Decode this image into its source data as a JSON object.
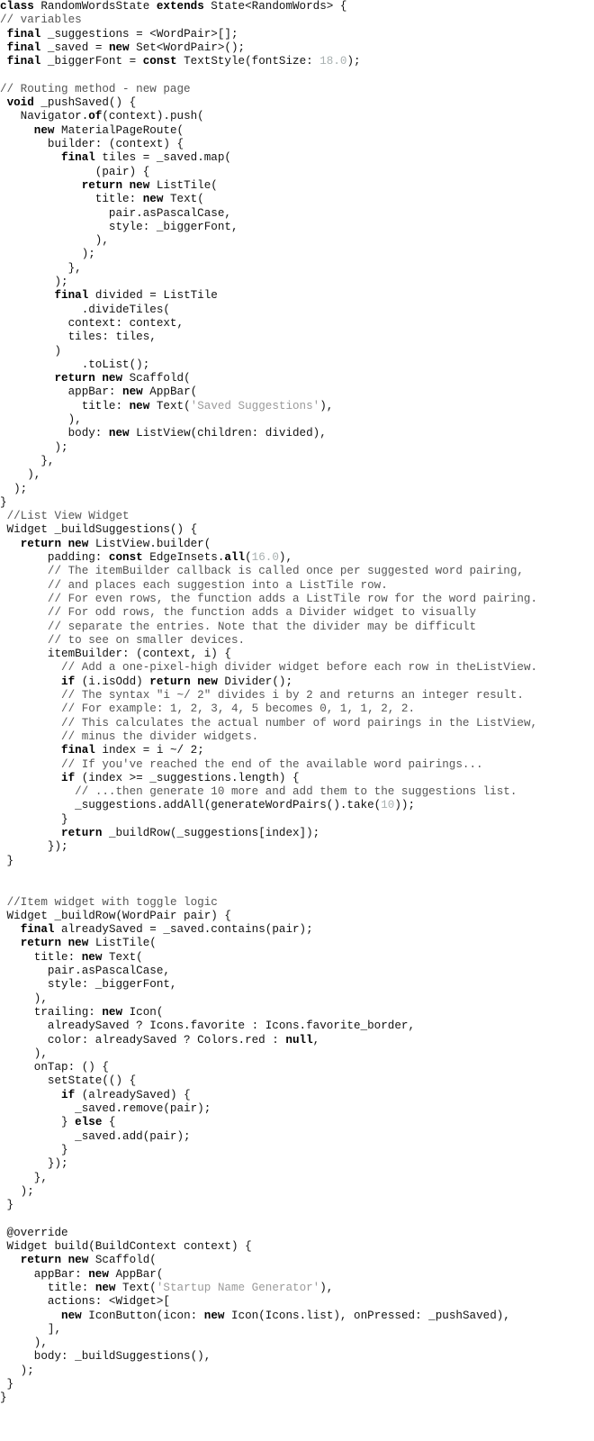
{
  "colors": {
    "background": "#ffffff",
    "text": "#111111",
    "keyword": "#000000",
    "comment": "#555555",
    "string": "#9a9a9a",
    "number": "#a8b0b0"
  },
  "code_lines": [
    [
      [
        "k",
        "class"
      ],
      [
        "p",
        " RandomWordsState "
      ],
      [
        "k",
        "extends"
      ],
      [
        "p",
        " State<RandomWords> {"
      ]
    ],
    [
      [
        "c",
        "// variables"
      ]
    ],
    [
      [
        "p",
        " "
      ],
      [
        "k",
        "final"
      ],
      [
        "p",
        " _suggestions = <WordPair>[];"
      ]
    ],
    [
      [
        "p",
        " "
      ],
      [
        "k",
        "final"
      ],
      [
        "p",
        " _saved = "
      ],
      [
        "k",
        "new"
      ],
      [
        "p",
        " Set<WordPair>();"
      ]
    ],
    [
      [
        "p",
        " "
      ],
      [
        "k",
        "final"
      ],
      [
        "p",
        " _biggerFont = "
      ],
      [
        "k",
        "const"
      ],
      [
        "p",
        " TextStyle(fontSize: "
      ],
      [
        "n",
        "18.0"
      ],
      [
        "p",
        ");"
      ]
    ],
    [],
    [
      [
        "c",
        "// Routing method - new page"
      ]
    ],
    [
      [
        "p",
        " "
      ],
      [
        "k",
        "void"
      ],
      [
        "p",
        " _pushSaved() {"
      ]
    ],
    [
      [
        "p",
        "   Navigator."
      ],
      [
        "k",
        "of"
      ],
      [
        "p",
        "(context).push("
      ]
    ],
    [
      [
        "p",
        "     "
      ],
      [
        "k",
        "new"
      ],
      [
        "p",
        " MaterialPageRoute("
      ]
    ],
    [
      [
        "p",
        "       builder: (context) {"
      ]
    ],
    [
      [
        "p",
        "         "
      ],
      [
        "k",
        "final"
      ],
      [
        "p",
        " tiles = _saved.map("
      ]
    ],
    [
      [
        "p",
        "              (pair) {"
      ]
    ],
    [
      [
        "p",
        "            "
      ],
      [
        "k",
        "return new"
      ],
      [
        "p",
        " ListTile("
      ]
    ],
    [
      [
        "p",
        "              title: "
      ],
      [
        "k",
        "new"
      ],
      [
        "p",
        " Text("
      ]
    ],
    [
      [
        "p",
        "                pair.asPascalCase,"
      ]
    ],
    [
      [
        "p",
        "                style: _biggerFont,"
      ]
    ],
    [
      [
        "p",
        "              ),"
      ]
    ],
    [
      [
        "p",
        "            );"
      ]
    ],
    [
      [
        "p",
        "          },"
      ]
    ],
    [
      [
        "p",
        "        );"
      ]
    ],
    [
      [
        "p",
        "        "
      ],
      [
        "k",
        "final"
      ],
      [
        "p",
        " divided = ListTile"
      ]
    ],
    [
      [
        "p",
        "            .divideTiles("
      ]
    ],
    [
      [
        "p",
        "          context: context,"
      ]
    ],
    [
      [
        "p",
        "          tiles: tiles,"
      ]
    ],
    [
      [
        "p",
        "        )"
      ]
    ],
    [
      [
        "p",
        "            .toList();"
      ]
    ],
    [
      [
        "p",
        "        "
      ],
      [
        "k",
        "return new"
      ],
      [
        "p",
        " Scaffold("
      ]
    ],
    [
      [
        "p",
        "          appBar: "
      ],
      [
        "k",
        "new"
      ],
      [
        "p",
        " AppBar("
      ]
    ],
    [
      [
        "p",
        "            title: "
      ],
      [
        "k",
        "new"
      ],
      [
        "p",
        " Text("
      ],
      [
        "s",
        "'Saved Suggestions'"
      ],
      [
        "p",
        "),"
      ]
    ],
    [
      [
        "p",
        "          ),"
      ]
    ],
    [
      [
        "p",
        "          body: "
      ],
      [
        "k",
        "new"
      ],
      [
        "p",
        " ListView(children: divided),"
      ]
    ],
    [
      [
        "p",
        "        );"
      ]
    ],
    [
      [
        "p",
        "      },"
      ]
    ],
    [
      [
        "p",
        "    ),"
      ]
    ],
    [
      [
        "p",
        "  );"
      ]
    ],
    [
      [
        "p",
        "}"
      ]
    ],
    [
      [
        "p",
        " "
      ],
      [
        "c",
        "//List View Widget"
      ]
    ],
    [
      [
        "p",
        " Widget _buildSuggestions() {"
      ]
    ],
    [
      [
        "p",
        "   "
      ],
      [
        "k",
        "return new"
      ],
      [
        "p",
        " ListView.builder("
      ]
    ],
    [
      [
        "p",
        "       padding: "
      ],
      [
        "k",
        "const"
      ],
      [
        "p",
        " EdgeInsets."
      ],
      [
        "k",
        "all"
      ],
      [
        "p",
        "("
      ],
      [
        "n",
        "16.0"
      ],
      [
        "p",
        "),"
      ]
    ],
    [
      [
        "p",
        "       "
      ],
      [
        "c",
        "// The itemBuilder callback is called once per suggested word pairing,"
      ]
    ],
    [
      [
        "p",
        "       "
      ],
      [
        "c",
        "// and places each suggestion into a ListTile row."
      ]
    ],
    [
      [
        "p",
        "       "
      ],
      [
        "c",
        "// For even rows, the function adds a ListTile row for the word pairing."
      ]
    ],
    [
      [
        "p",
        "       "
      ],
      [
        "c",
        "// For odd rows, the function adds a Divider widget to visually"
      ]
    ],
    [
      [
        "p",
        "       "
      ],
      [
        "c",
        "// separate the entries. Note that the divider may be difficult"
      ]
    ],
    [
      [
        "p",
        "       "
      ],
      [
        "c",
        "// to see on smaller devices."
      ]
    ],
    [
      [
        "p",
        "       itemBuilder: (context, i) {"
      ]
    ],
    [
      [
        "p",
        "         "
      ],
      [
        "c",
        "// Add a one-pixel-high divider widget before each row in theListView."
      ]
    ],
    [
      [
        "p",
        "         "
      ],
      [
        "k",
        "if"
      ],
      [
        "p",
        " (i.isOdd) "
      ],
      [
        "k",
        "return new"
      ],
      [
        "p",
        " Divider();"
      ]
    ],
    [
      [
        "p",
        "         "
      ],
      [
        "c",
        "// The syntax \"i ~/ 2\" divides i by 2 and returns an integer result."
      ]
    ],
    [
      [
        "p",
        "         "
      ],
      [
        "c",
        "// For example: 1, 2, 3, 4, 5 becomes 0, 1, 1, 2, 2."
      ]
    ],
    [
      [
        "p",
        "         "
      ],
      [
        "c",
        "// This calculates the actual number of word pairings in the ListView,"
      ]
    ],
    [
      [
        "p",
        "         "
      ],
      [
        "c",
        "// minus the divider widgets."
      ]
    ],
    [
      [
        "p",
        "         "
      ],
      [
        "k",
        "final"
      ],
      [
        "p",
        " index = i ~/ 2;"
      ]
    ],
    [
      [
        "p",
        "         "
      ],
      [
        "c",
        "// If you've reached the end of the available word pairings..."
      ]
    ],
    [
      [
        "p",
        "         "
      ],
      [
        "k",
        "if"
      ],
      [
        "p",
        " (index >= _suggestions.length) {"
      ]
    ],
    [
      [
        "p",
        "           "
      ],
      [
        "c",
        "// ...then generate 10 more and add them to the suggestions list."
      ]
    ],
    [
      [
        "p",
        "           _suggestions.addAll(generateWordPairs().take("
      ],
      [
        "n",
        "10"
      ],
      [
        "p",
        "));"
      ]
    ],
    [
      [
        "p",
        "         }"
      ]
    ],
    [
      [
        "p",
        "         "
      ],
      [
        "k",
        "return"
      ],
      [
        "p",
        " _buildRow(_suggestions[index]);"
      ]
    ],
    [
      [
        "p",
        "       });"
      ]
    ],
    [
      [
        "p",
        " }"
      ]
    ],
    [],
    [],
    [
      [
        "p",
        " "
      ],
      [
        "c",
        "//Item widget with toggle logic"
      ]
    ],
    [
      [
        "p",
        " Widget _buildRow(WordPair pair) {"
      ]
    ],
    [
      [
        "p",
        "   "
      ],
      [
        "k",
        "final"
      ],
      [
        "p",
        " alreadySaved = _saved.contains(pair);"
      ]
    ],
    [
      [
        "p",
        "   "
      ],
      [
        "k",
        "return new"
      ],
      [
        "p",
        " ListTile("
      ]
    ],
    [
      [
        "p",
        "     title: "
      ],
      [
        "k",
        "new"
      ],
      [
        "p",
        " Text("
      ]
    ],
    [
      [
        "p",
        "       pair.asPascalCase,"
      ]
    ],
    [
      [
        "p",
        "       style: _biggerFont,"
      ]
    ],
    [
      [
        "p",
        "     ),"
      ]
    ],
    [
      [
        "p",
        "     trailing: "
      ],
      [
        "k",
        "new"
      ],
      [
        "p",
        " Icon("
      ]
    ],
    [
      [
        "p",
        "       alreadySaved ? Icons.favorite : Icons.favorite_border,"
      ]
    ],
    [
      [
        "p",
        "       color: alreadySaved ? Colors.red : "
      ],
      [
        "k",
        "null"
      ],
      [
        "p",
        ","
      ]
    ],
    [
      [
        "p",
        "     ),"
      ]
    ],
    [
      [
        "p",
        "     onTap: () {"
      ]
    ],
    [
      [
        "p",
        "       setState(() {"
      ]
    ],
    [
      [
        "p",
        "         "
      ],
      [
        "k",
        "if"
      ],
      [
        "p",
        " (alreadySaved) {"
      ]
    ],
    [
      [
        "p",
        "           _saved.remove(pair);"
      ]
    ],
    [
      [
        "p",
        "         } "
      ],
      [
        "k",
        "else"
      ],
      [
        "p",
        " {"
      ]
    ],
    [
      [
        "p",
        "           _saved.add(pair);"
      ]
    ],
    [
      [
        "p",
        "         }"
      ]
    ],
    [
      [
        "p",
        "       });"
      ]
    ],
    [
      [
        "p",
        "     },"
      ]
    ],
    [
      [
        "p",
        "   );"
      ]
    ],
    [
      [
        "p",
        " }"
      ]
    ],
    [],
    [
      [
        "p",
        " @override"
      ]
    ],
    [
      [
        "p",
        " Widget build(BuildContext context) {"
      ]
    ],
    [
      [
        "p",
        "   "
      ],
      [
        "k",
        "return new"
      ],
      [
        "p",
        " Scaffold("
      ]
    ],
    [
      [
        "p",
        "     appBar: "
      ],
      [
        "k",
        "new"
      ],
      [
        "p",
        " AppBar("
      ]
    ],
    [
      [
        "p",
        "       title: "
      ],
      [
        "k",
        "new"
      ],
      [
        "p",
        " Text("
      ],
      [
        "s",
        "'Startup Name Generator'"
      ],
      [
        "p",
        "),"
      ]
    ],
    [
      [
        "p",
        "       actions: <Widget>["
      ]
    ],
    [
      [
        "p",
        "         "
      ],
      [
        "k",
        "new"
      ],
      [
        "p",
        " IconButton(icon: "
      ],
      [
        "k",
        "new"
      ],
      [
        "p",
        " Icon(Icons.list), onPressed: _pushSaved),"
      ]
    ],
    [
      [
        "p",
        "       ],"
      ]
    ],
    [
      [
        "p",
        "     ),"
      ]
    ],
    [
      [
        "p",
        "     body: _buildSuggestions(),"
      ]
    ],
    [
      [
        "p",
        "   );"
      ]
    ],
    [
      [
        "p",
        " }"
      ]
    ],
    [
      [
        "p",
        "}"
      ]
    ]
  ]
}
